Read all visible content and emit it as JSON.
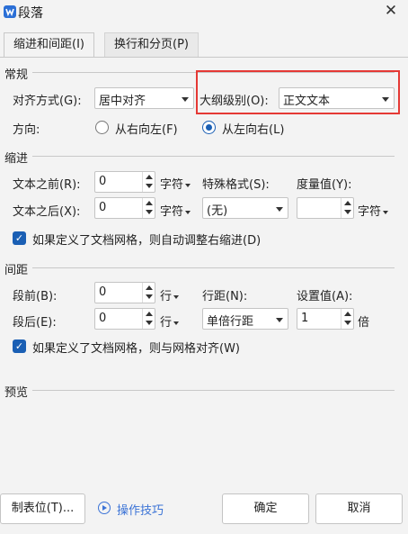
{
  "window": {
    "title": "段落",
    "close_glyph": "✕"
  },
  "tabs": [
    {
      "label": "缩进和间距(I)"
    },
    {
      "label": "换行和分页(P)"
    }
  ],
  "general": {
    "section_title": "常规",
    "alignment_label": "对齐方式(G):",
    "alignment_value": "居中对齐",
    "outline_label": "大纲级别(O):",
    "outline_value": "正文文本",
    "direction_label": "方向:",
    "rtl_label": "从右向左(F)",
    "ltr_label": "从左向右(L)"
  },
  "indent": {
    "section_title": "缩进",
    "before_label": "文本之前(R):",
    "before_value": "0",
    "before_unit": "字符",
    "after_label": "文本之后(X):",
    "after_value": "0",
    "after_unit": "字符",
    "special_label": "特殊格式(S):",
    "special_value": "(无)",
    "measure_label": "度量值(Y):",
    "measure_value": "",
    "measure_unit": "字符",
    "auto_adjust_label": "如果定义了文档网格，则自动调整右缩进(D)"
  },
  "spacing": {
    "section_title": "间距",
    "before_label": "段前(B):",
    "before_value": "0",
    "before_unit": "行",
    "after_label": "段后(E):",
    "after_value": "0",
    "after_unit": "行",
    "line_label": "行距(N):",
    "line_value": "单倍行距",
    "setting_label": "设置值(A):",
    "setting_value": "1",
    "setting_unit": "倍",
    "snap_grid_label": "如果定义了文档网格，则与网格对齐(W)"
  },
  "preview": {
    "section_title": "预览"
  },
  "footer": {
    "tabs_button": "制表位(T)...",
    "tips_link": "操作技巧",
    "ok_button": "确定",
    "cancel_button": "取消"
  },
  "colors": {
    "accent": "#1a5fb4",
    "highlight_box": "#e53935",
    "link": "#3b73d6"
  }
}
